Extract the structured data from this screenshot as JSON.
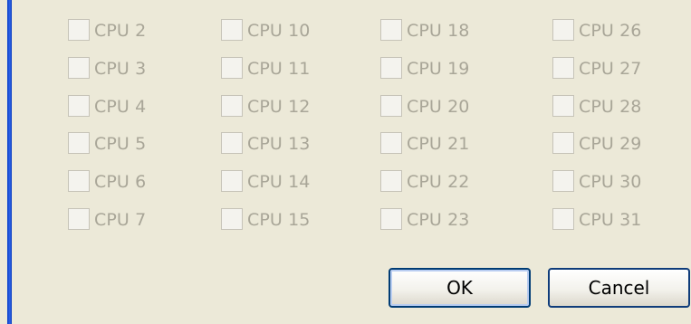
{
  "cpu_columns": [
    {
      "items": [
        {
          "label": "CPU 2",
          "checked": false
        },
        {
          "label": "CPU 3",
          "checked": false
        },
        {
          "label": "CPU 4",
          "checked": false
        },
        {
          "label": "CPU 5",
          "checked": false
        },
        {
          "label": "CPU 6",
          "checked": false
        },
        {
          "label": "CPU 7",
          "checked": false
        }
      ]
    },
    {
      "items": [
        {
          "label": "CPU 10",
          "checked": false
        },
        {
          "label": "CPU 11",
          "checked": false
        },
        {
          "label": "CPU 12",
          "checked": false
        },
        {
          "label": "CPU 13",
          "checked": false
        },
        {
          "label": "CPU 14",
          "checked": false
        },
        {
          "label": "CPU 15",
          "checked": false
        }
      ]
    },
    {
      "items": [
        {
          "label": "CPU 18",
          "checked": false
        },
        {
          "label": "CPU 19",
          "checked": false
        },
        {
          "label": "CPU 20",
          "checked": false
        },
        {
          "label": "CPU 21",
          "checked": false
        },
        {
          "label": "CPU 22",
          "checked": false
        },
        {
          "label": "CPU 23",
          "checked": false
        }
      ]
    },
    {
      "items": [
        {
          "label": "CPU 26",
          "checked": false
        },
        {
          "label": "CPU 27",
          "checked": false
        },
        {
          "label": "CPU 28",
          "checked": false
        },
        {
          "label": "CPU 29",
          "checked": false
        },
        {
          "label": "CPU 30",
          "checked": false
        },
        {
          "label": "CPU 31",
          "checked": false
        }
      ]
    }
  ],
  "buttons": {
    "ok_label": "OK",
    "cancel_label": "Cancel"
  },
  "colors": {
    "dialog_background": "#ece9d8",
    "window_frame": "#2d63e8",
    "disabled_text": "#a9a698",
    "button_border": "#003c74"
  }
}
